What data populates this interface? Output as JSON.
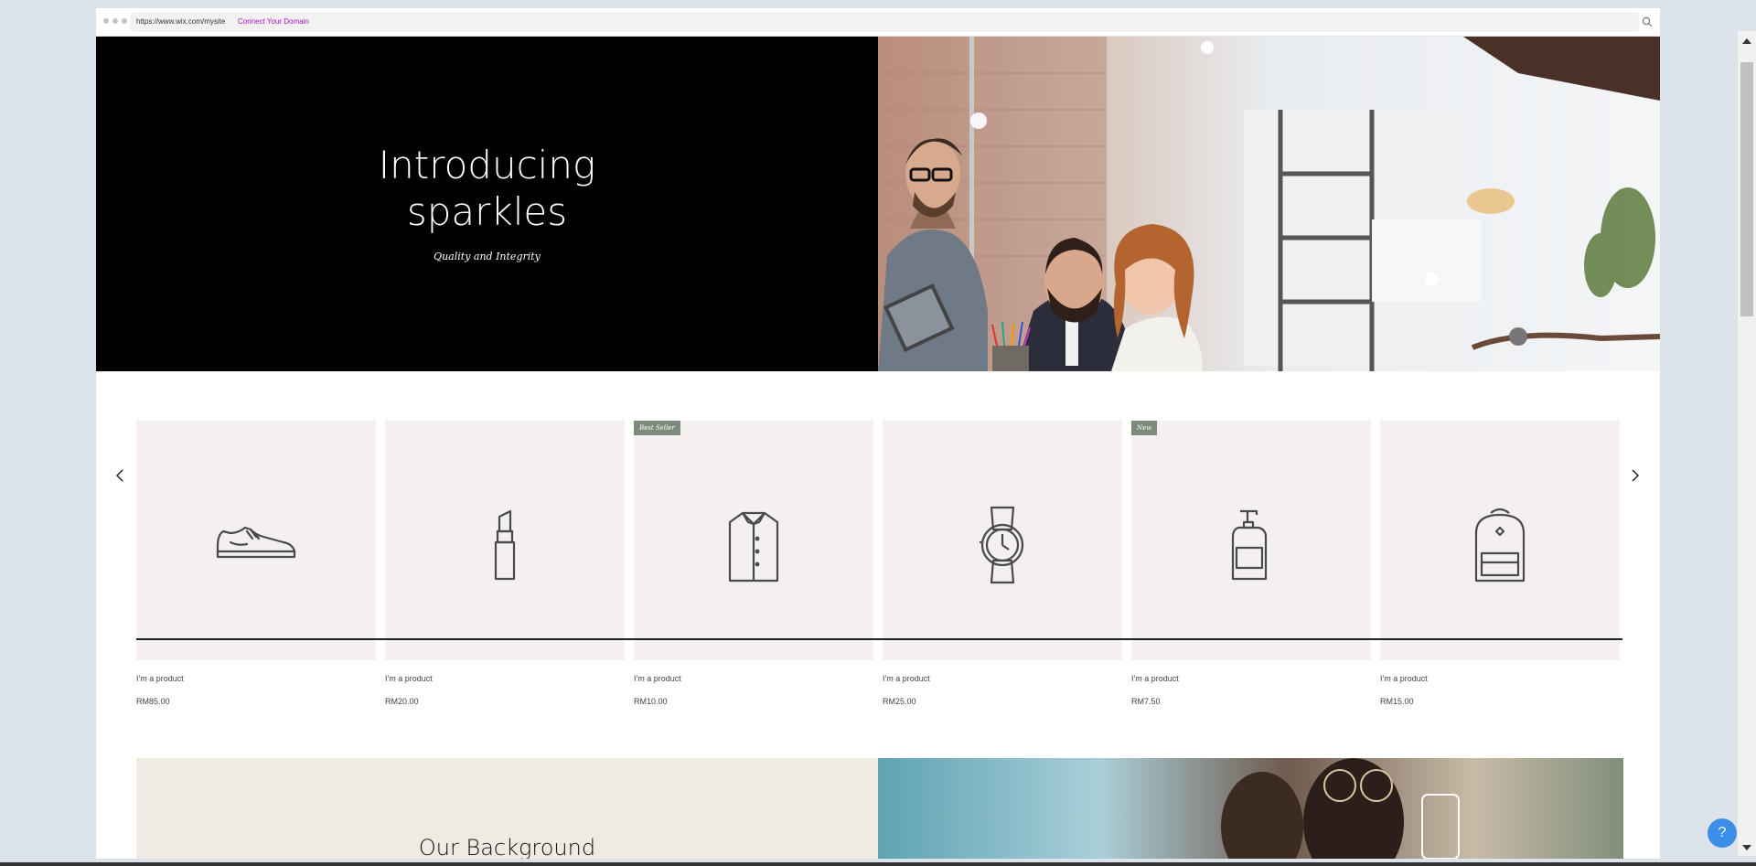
{
  "browser": {
    "url": "https://www.wix.com/mysite",
    "connect_link": "Connect Your Domain",
    "search_icon": "search-icon"
  },
  "hero": {
    "title_line1": "Introducing",
    "title_line2": "sparkles",
    "subtitle": "Quality and Integrity"
  },
  "products": [
    {
      "name": "I'm a product",
      "price": "RM85.00",
      "icon": "shoe-icon",
      "ribbon": ""
    },
    {
      "name": "I'm a product",
      "price": "RM20.00",
      "icon": "lipstick-icon",
      "ribbon": ""
    },
    {
      "name": "I'm a product",
      "price": "RM10.00",
      "icon": "shirt-icon",
      "ribbon": "Best Seller"
    },
    {
      "name": "I'm a product",
      "price": "RM25.00",
      "icon": "watch-icon",
      "ribbon": ""
    },
    {
      "name": "I'm a product",
      "price": "RM7.50",
      "icon": "soap-bottle-icon",
      "ribbon": "New"
    },
    {
      "name": "I'm a product",
      "price": "RM15.00",
      "icon": "backpack-icon",
      "ribbon": ""
    }
  ],
  "background_section": {
    "title": "Our Background"
  },
  "help": {
    "label": "?"
  },
  "colors": {
    "hero_bg": "#000000",
    "card_bg": "#f3f0ef",
    "ribbon_bg": "#7b8a7a",
    "section_bg": "#efebe3",
    "link": "#b10ec9",
    "help_button": "#3b8fe8"
  }
}
